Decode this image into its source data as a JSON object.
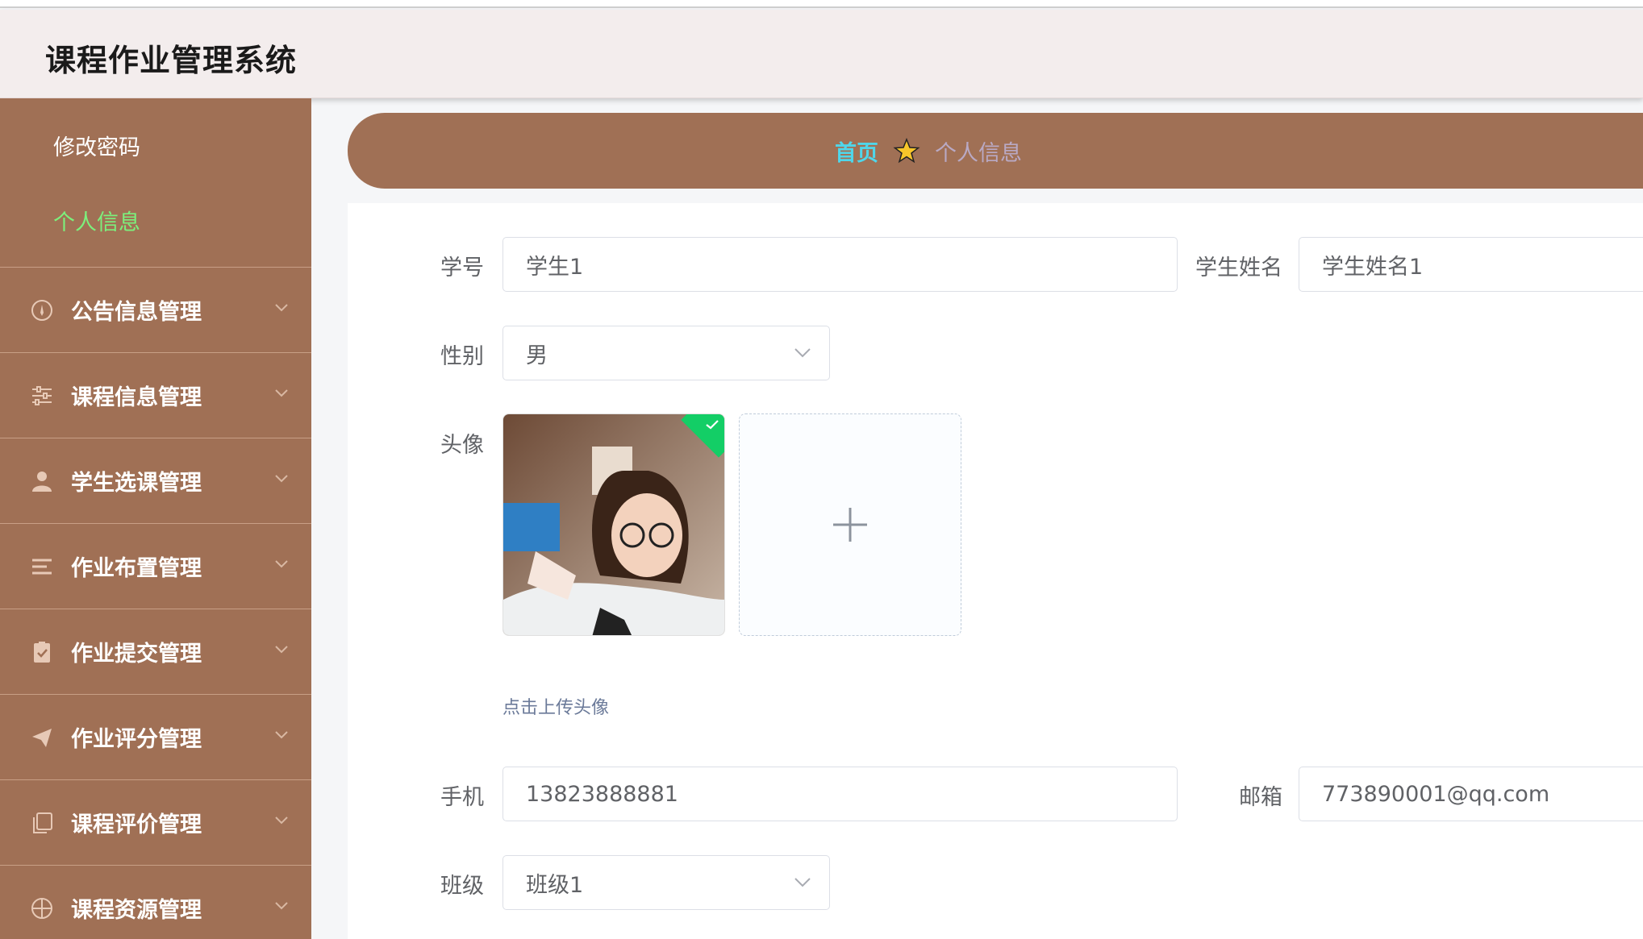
{
  "header": {
    "title": "课程作业管理系统"
  },
  "sidebar": {
    "sub_items": [
      {
        "label": "修改密码",
        "active": false
      },
      {
        "label": "个人信息",
        "active": true
      }
    ],
    "menu": [
      {
        "label": "公告信息管理",
        "icon": "info-circle-icon"
      },
      {
        "label": "课程信息管理",
        "icon": "sliders-icon"
      },
      {
        "label": "学生选课管理",
        "icon": "user-icon"
      },
      {
        "label": "作业布置管理",
        "icon": "list-icon"
      },
      {
        "label": "作业提交管理",
        "icon": "clipboard-check-icon"
      },
      {
        "label": "作业评分管理",
        "icon": "paper-plane-icon"
      },
      {
        "label": "课程评价管理",
        "icon": "copy-icon"
      },
      {
        "label": "课程资源管理",
        "icon": "compass-icon"
      }
    ]
  },
  "breadcrumb": {
    "home": "首页",
    "current": "个人信息"
  },
  "form": {
    "student_no": {
      "label": "学号",
      "value": "学生1"
    },
    "student_name": {
      "label": "学生姓名",
      "value": "学生姓名1"
    },
    "gender": {
      "label": "性别",
      "value": "男"
    },
    "avatar": {
      "label": "头像",
      "tip": "点击上传头像"
    },
    "phone": {
      "label": "手机",
      "value": "13823888881"
    },
    "email": {
      "label": "邮箱",
      "value": "773890001@qq.com"
    },
    "class": {
      "label": "班级",
      "value": "班级1"
    }
  },
  "colors": {
    "sidebar_bg": "#a07055",
    "header_bg": "#f3eded",
    "active_menu": "#7cf07c",
    "breadcrumb_home": "#4fd6ea",
    "success_badge": "#13ce66"
  }
}
